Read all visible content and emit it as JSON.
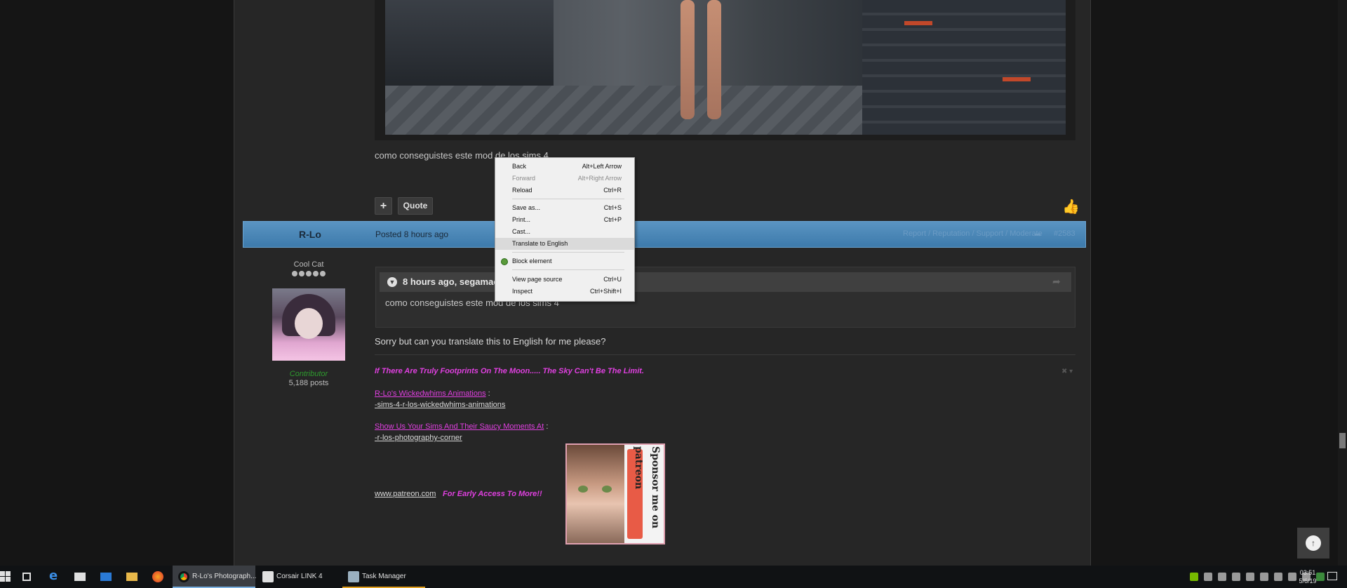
{
  "previous_post": {
    "quoted_text": "como conseguistes este mod de los sims 4",
    "buttons": {
      "plus_label": "+",
      "quote_label": "Quote"
    }
  },
  "post": {
    "author": "R-Lo",
    "posted_label": "Posted 8 hours ago",
    "tools": "Report / Reputation / Support / Moderate",
    "number": "#2583",
    "author_info": {
      "title": "Cool Cat",
      "group": "Contributor",
      "post_count": "5,188 posts"
    },
    "quote": {
      "header": "8 hours ago, segamac",
      "body": "como conseguistes este mod de los sims 4"
    },
    "reply": "Sorry but can you translate this to English for me please?",
    "signature": {
      "tagline": "If There Are Truly Footprints On The Moon..... The Sky Can't Be The Limit.",
      "link1_label": "R-Lo's Wickedwhims Animations",
      "link1_colon": " :",
      "link1_sub": "-sims-4-r-los-wickedwhims-animations",
      "link2_label": "Show Us Your Sims And Their Saucy Moments At",
      "link2_colon": " :",
      "link2_sub": "-r-los-photography-corner",
      "patreon_url": "www.patreon.com",
      "early_access": "For Early Access To More!!",
      "banner_text": "Sponsor me on patreon"
    }
  },
  "context_menu": {
    "items": [
      {
        "label": "Back",
        "shortcut": "Alt+Left Arrow"
      },
      {
        "label": "Forward",
        "shortcut": "Alt+Right Arrow"
      },
      {
        "label": "Reload",
        "shortcut": "Ctrl+R"
      },
      {
        "label": "Save as...",
        "shortcut": "Ctrl+S"
      },
      {
        "label": "Print...",
        "shortcut": "Ctrl+P"
      },
      {
        "label": "Cast...",
        "shortcut": ""
      },
      {
        "label": "Translate to English",
        "shortcut": ""
      },
      {
        "label": "Block element",
        "shortcut": ""
      },
      {
        "label": "View page source",
        "shortcut": "Ctrl+U"
      },
      {
        "label": "Inspect",
        "shortcut": "Ctrl+Shift+I"
      }
    ]
  },
  "taskbar": {
    "apps": [
      {
        "label": "R-Lo's Photograph..."
      },
      {
        "label": "Corsair LINK 4"
      },
      {
        "label": "Task Manager"
      }
    ],
    "time": "03:51",
    "date": "5/6/19"
  },
  "colors": {
    "post_header": "#3d7aab",
    "signature_pink": "#e040e0",
    "contributor_green": "#2e9b2e"
  }
}
